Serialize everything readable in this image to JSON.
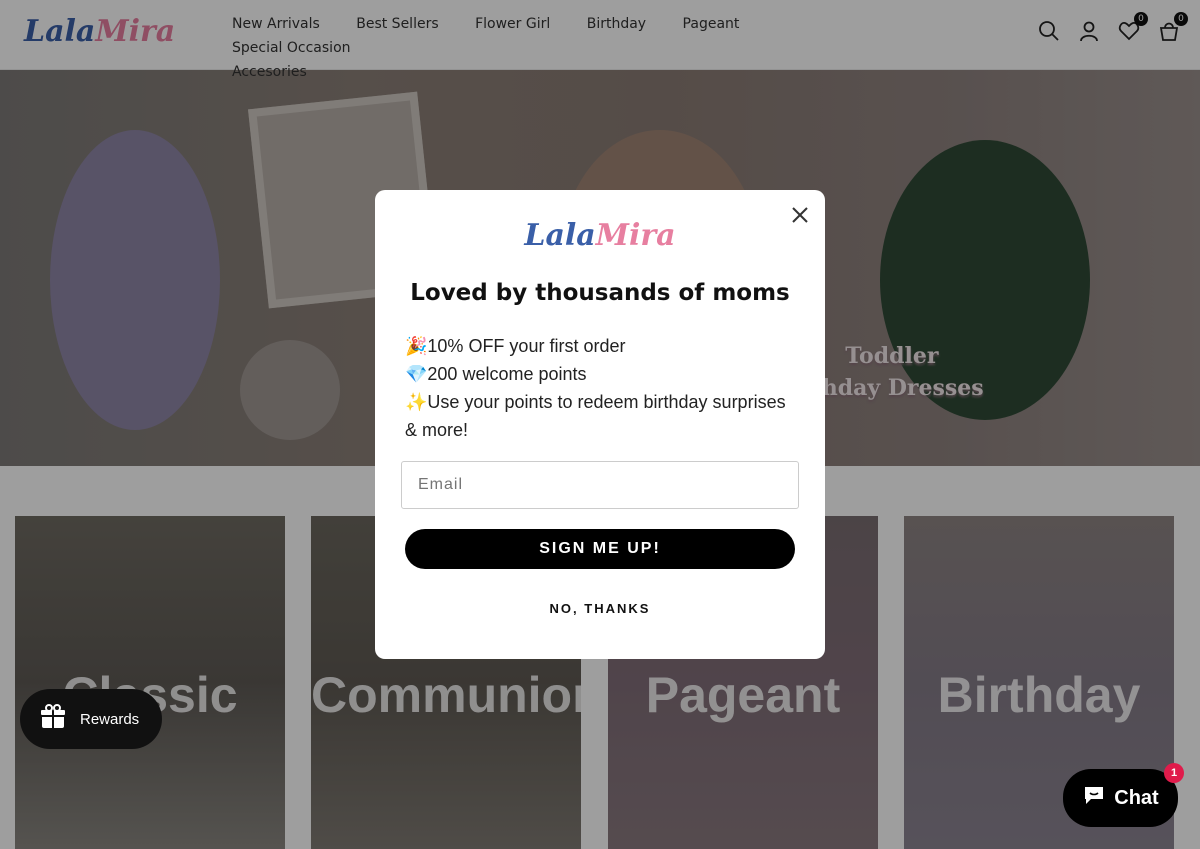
{
  "header": {
    "logo_part1": "Lala",
    "logo_part2": "Mira",
    "nav": [
      "New Arrivals",
      "Best Sellers",
      "Flower Girl",
      "Birthday",
      "Pageant",
      "Special Occasion",
      "Accesories"
    ],
    "wishlist_count": "0",
    "cart_count": "0",
    "icons": [
      "search-icon",
      "account-icon",
      "wishlist-icon",
      "cart-icon"
    ]
  },
  "hero": {
    "line1": "Toddler",
    "line2": "rthday Dresses"
  },
  "categories": [
    "Classic",
    "Communion",
    "Pageant",
    "Birthday"
  ],
  "modal": {
    "logo_part1": "Lala",
    "logo_part2": "Mira",
    "title": "Loved by thousands of moms",
    "perks": [
      "🎉10% OFF your first order",
      "💎200 welcome points",
      "✨Use your points to redeem birthday surprises & more!"
    ],
    "email_placeholder": "Email",
    "signup_label": "SIGN ME UP!",
    "no_thanks_label": "NO, THANKS"
  },
  "rewards": {
    "label": "Rewards"
  },
  "chat": {
    "label": "Chat",
    "badge": "1"
  },
  "colors": {
    "brand_blue": "#3a5fa8",
    "brand_pink": "#e77fa0",
    "button": "#000000",
    "chat_badge": "#e01b4b"
  }
}
